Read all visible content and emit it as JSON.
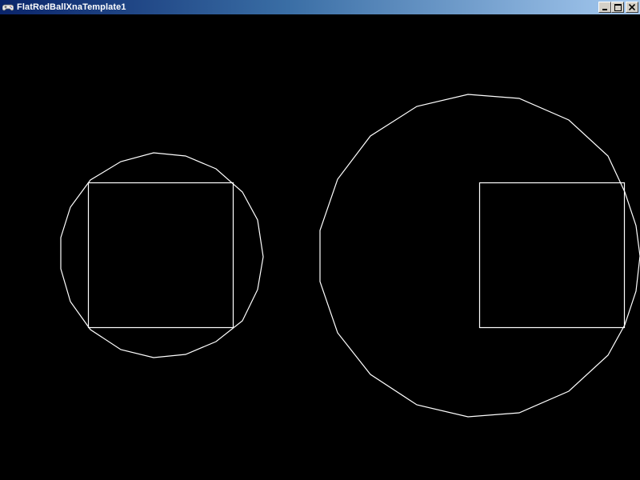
{
  "window": {
    "title": "FlatRedBallXnaTemplate1",
    "app_icon": "gamepad-icon",
    "controls": [
      "minimize-icon",
      "maximize-icon",
      "close-icon"
    ]
  },
  "scene": {
    "background_color": "#000000",
    "stroke_color": "#ffffff"
  }
}
